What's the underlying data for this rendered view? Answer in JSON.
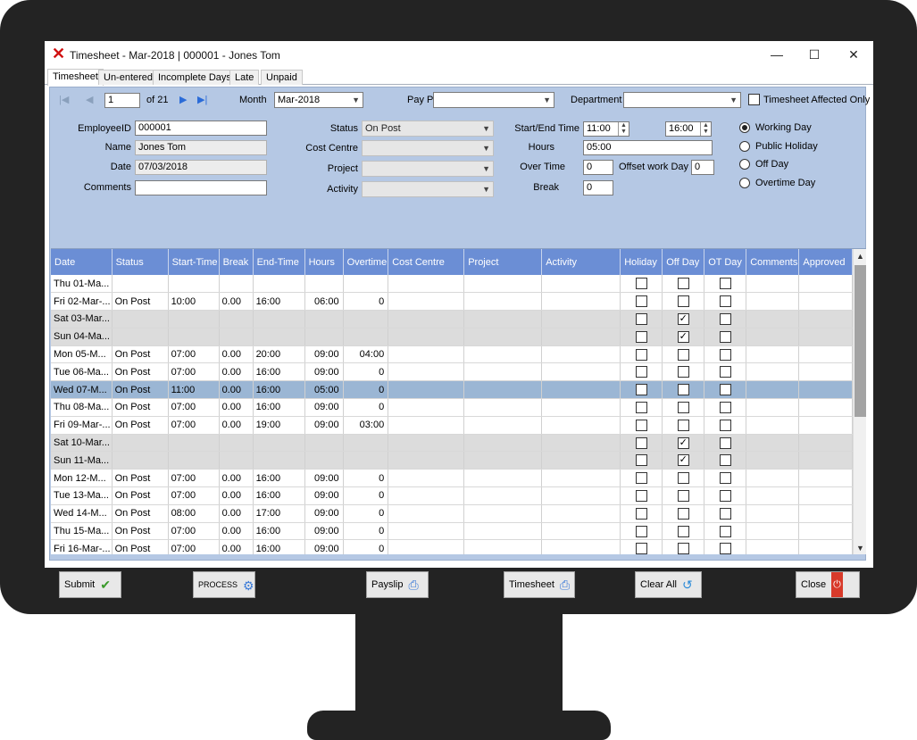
{
  "window": {
    "title": "Timesheet - Mar-2018 | 000001 - Jones Tom"
  },
  "icons": {
    "logo": "x-logo-icon",
    "minimize": "minimize-icon",
    "maximize": "maximize-icon",
    "close": "close-icon"
  },
  "tabs": [
    "Timesheet",
    "Un-entered",
    "Incomplete Days",
    "Late",
    "Unpaid"
  ],
  "nav": {
    "record": "1",
    "of_label": "of 21"
  },
  "filters": {
    "month_label": "Month",
    "month_value": "Mar-2018",
    "paypoint_label": "Pay Point",
    "paypoint_value": "",
    "department_label": "Department",
    "department_value": "",
    "affected_only_label": "Timesheet Affected Only"
  },
  "form": {
    "employee_id_label": "EmployeeID",
    "employee_id": "000001",
    "name_label": "Name",
    "name": "Jones Tom",
    "date_label": "Date",
    "date": "07/03/2018",
    "comments_label": "Comments",
    "comments": "",
    "status_label": "Status",
    "status": "On Post",
    "cost_centre_label": "Cost Centre",
    "cost_centre": "",
    "project_label": "Project",
    "project": "",
    "activity_label": "Activity",
    "activity": "",
    "start_end_label": "Start/End Time",
    "start_time": "11:00",
    "end_time": "16:00",
    "hours_label": "Hours",
    "hours": "05:00",
    "overtime_label": "Over Time",
    "overtime": "0",
    "offset_label": "Offset work Day",
    "offset": "0",
    "break_label": "Break",
    "break": "0"
  },
  "day_types": [
    "Working Day",
    "Public Holiday",
    "Off Day",
    "Overtime Day"
  ],
  "day_type_selected": 0,
  "grid": {
    "columns": [
      "Date",
      "Status",
      "Start-Time",
      "Break",
      "End-Time",
      "Hours",
      "Overtime",
      "Cost Centre",
      "Project",
      "Activity",
      "Holiday",
      "Off Day",
      "OT Day",
      "Comments",
      "Approved"
    ],
    "rows": [
      {
        "date": "Thu 01-Ma...",
        "status": "",
        "start": "",
        "brk": "",
        "end": "",
        "hours": "",
        "ot": "",
        "holiday": false,
        "off": false,
        "otday": false,
        "weekend": false
      },
      {
        "date": "Fri 02-Mar-...",
        "status": "On Post",
        "start": "10:00",
        "brk": "0.00",
        "end": "16:00",
        "hours": "06:00",
        "ot": "0",
        "holiday": false,
        "off": false,
        "otday": false,
        "weekend": false
      },
      {
        "date": "Sat 03-Mar...",
        "status": "",
        "start": "",
        "brk": "",
        "end": "",
        "hours": "",
        "ot": "",
        "holiday": false,
        "off": true,
        "otday": false,
        "weekend": true
      },
      {
        "date": "Sun 04-Ma...",
        "status": "",
        "start": "",
        "brk": "",
        "end": "",
        "hours": "",
        "ot": "",
        "holiday": false,
        "off": true,
        "otday": false,
        "weekend": true
      },
      {
        "date": "Mon 05-M...",
        "status": "On Post",
        "start": "07:00",
        "brk": "0.00",
        "end": "20:00",
        "hours": "09:00",
        "ot": "04:00",
        "holiday": false,
        "off": false,
        "otday": false,
        "weekend": false
      },
      {
        "date": "Tue 06-Ma...",
        "status": "On Post",
        "start": "07:00",
        "brk": "0.00",
        "end": "16:00",
        "hours": "09:00",
        "ot": "0",
        "holiday": false,
        "off": false,
        "otday": false,
        "weekend": false
      },
      {
        "date": "Wed 07-M...",
        "status": "On Post",
        "start": "11:00",
        "brk": "0.00",
        "end": "16:00",
        "hours": "05:00",
        "ot": "0",
        "holiday": false,
        "off": false,
        "otday": false,
        "weekend": false,
        "selected": true
      },
      {
        "date": "Thu 08-Ma...",
        "status": "On Post",
        "start": "07:00",
        "brk": "0.00",
        "end": "16:00",
        "hours": "09:00",
        "ot": "0",
        "holiday": false,
        "off": false,
        "otday": false,
        "weekend": false
      },
      {
        "date": "Fri 09-Mar-...",
        "status": "On Post",
        "start": "07:00",
        "brk": "0.00",
        "end": "19:00",
        "hours": "09:00",
        "ot": "03:00",
        "holiday": false,
        "off": false,
        "otday": false,
        "weekend": false
      },
      {
        "date": "Sat 10-Mar...",
        "status": "",
        "start": "",
        "brk": "",
        "end": "",
        "hours": "",
        "ot": "",
        "holiday": false,
        "off": true,
        "otday": false,
        "weekend": true
      },
      {
        "date": "Sun 11-Ma...",
        "status": "",
        "start": "",
        "brk": "",
        "end": "",
        "hours": "",
        "ot": "",
        "holiday": false,
        "off": true,
        "otday": false,
        "weekend": true
      },
      {
        "date": "Mon 12-M...",
        "status": "On Post",
        "start": "07:00",
        "brk": "0.00",
        "end": "16:00",
        "hours": "09:00",
        "ot": "0",
        "holiday": false,
        "off": false,
        "otday": false,
        "weekend": false
      },
      {
        "date": "Tue 13-Ma...",
        "status": "On Post",
        "start": "07:00",
        "brk": "0.00",
        "end": "16:00",
        "hours": "09:00",
        "ot": "0",
        "holiday": false,
        "off": false,
        "otday": false,
        "weekend": false
      },
      {
        "date": "Wed 14-M...",
        "status": "On Post",
        "start": "08:00",
        "brk": "0.00",
        "end": "17:00",
        "hours": "09:00",
        "ot": "0",
        "holiday": false,
        "off": false,
        "otday": false,
        "weekend": false
      },
      {
        "date": "Thu 15-Ma...",
        "status": "On Post",
        "start": "07:00",
        "brk": "0.00",
        "end": "16:00",
        "hours": "09:00",
        "ot": "0",
        "holiday": false,
        "off": false,
        "otday": false,
        "weekend": false
      },
      {
        "date": "Fri 16-Mar-...",
        "status": "On Post",
        "start": "07:00",
        "brk": "0.00",
        "end": "16:00",
        "hours": "09:00",
        "ot": "0",
        "holiday": false,
        "off": false,
        "otday": false,
        "weekend": false
      }
    ]
  },
  "buttons": {
    "submit": "Submit",
    "process": "PROCESS",
    "payslip": "Payslip",
    "timesheet": "Timesheet",
    "clear_all": "Clear All",
    "close": "Close"
  },
  "colors": {
    "panel": "#b5c8e4",
    "grid_header": "#6b8ed5",
    "selected_row": "#9bb6d4",
    "weekend_row": "#dcdcdc",
    "logo": "#d01010"
  }
}
